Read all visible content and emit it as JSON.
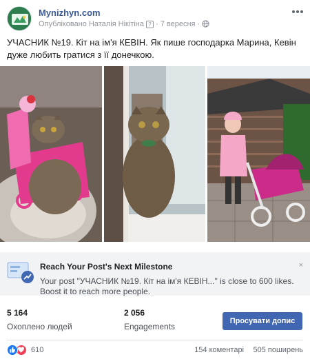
{
  "post": {
    "page_name": "Mynizhyn.com",
    "published_by": "Опубліковано Наталія Нікітіна",
    "info_marker": "?",
    "date": "7 вересня",
    "text": "УЧАСНИК №19. Кіт на ім'я КЕВІН. Як пише господарка Марина, Кевін дуже любить гратися з її донечкою."
  },
  "boost_banner": {
    "title": "Reach Your Post's Next Milestone",
    "text": "Your post \"УЧАСНИК №19. Кіт на ім'я КЕВІН...\" is close to 600 likes. Boost it to reach more people.",
    "close": "×"
  },
  "stats": {
    "reached_value": "5 164",
    "reached_label": "Охоплено людей",
    "engagements_value": "2 056",
    "engagements_label": "Engagements",
    "boost_button": "Просувати допис"
  },
  "footer": {
    "reactions_count": "610",
    "comments": "154 коментарі",
    "shares": "505 поширень"
  },
  "colors": {
    "link": "#385898",
    "button": "#4267b2",
    "banner_bg": "#f2f3f5",
    "like": "#1877f2",
    "love": "#f33e58"
  },
  "icons": [
    "page-avatar-icon",
    "globe-icon",
    "more-options-icon",
    "boost-chart-icon",
    "close-icon",
    "like-icon",
    "love-icon"
  ]
}
